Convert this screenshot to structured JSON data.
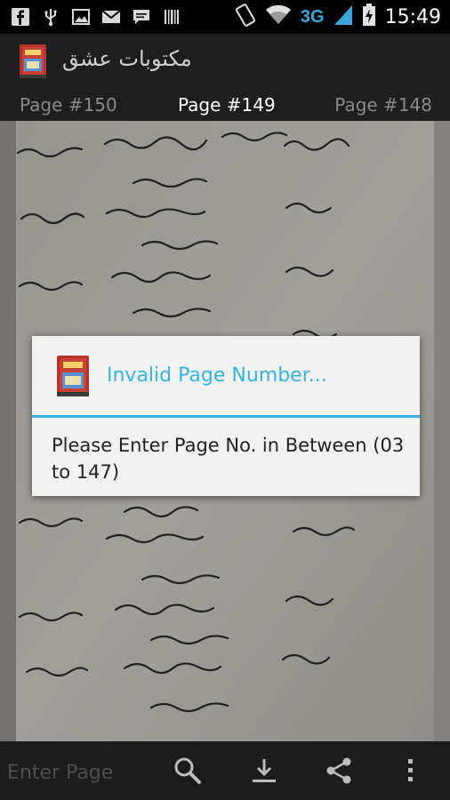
{
  "status_bar": {
    "network": "3G",
    "time": "15:49",
    "icons": [
      "facebook-icon",
      "usb-icon",
      "image-icon",
      "mail-icon",
      "chat-icon",
      "barcode-icon",
      "rotate-icon",
      "wifi-icon",
      "signal-icon",
      "battery-icon"
    ]
  },
  "action_bar": {
    "title": "مکتوبات عشق",
    "icon": "book-app-icon"
  },
  "page_tabs": {
    "previous": "Page #150",
    "current": "Page #149",
    "next": "Page #148"
  },
  "dialog": {
    "title": "Invalid Page Number...",
    "message": "Please Enter Page No. in Between (03 to 147)",
    "accent": "#33b5e5"
  },
  "bottom_bar": {
    "page_input_placeholder": "Enter Page",
    "icons": [
      "search-icon",
      "download-icon",
      "share-icon",
      "overflow-menu-icon"
    ]
  }
}
